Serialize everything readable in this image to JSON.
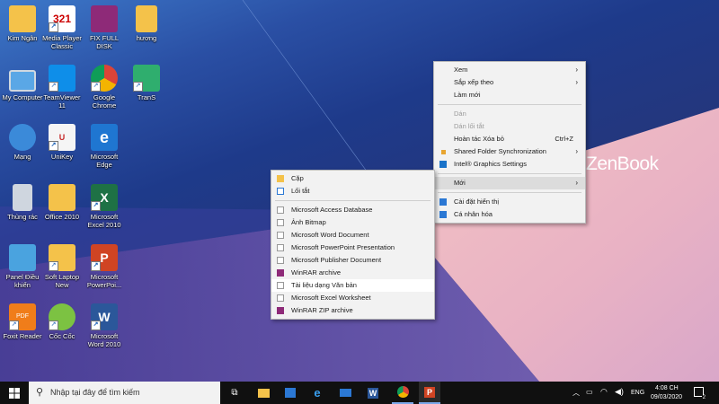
{
  "desktop": {
    "brand": "ZenBook",
    "icons": [
      {
        "label": "Kim Ngân",
        "icon": "folder-icon"
      },
      {
        "label": "Media Player Classic",
        "icon": "media-player-icon"
      },
      {
        "label": "FIX FULL DISK",
        "icon": "winrar-icon"
      },
      {
        "label": "hương",
        "icon": "folder-icon"
      },
      {
        "label": "My Computer",
        "icon": "computer-icon"
      },
      {
        "label": "TeamViewer 11",
        "icon": "teamviewer-icon"
      },
      {
        "label": "Google Chrome",
        "icon": "chrome-icon"
      },
      {
        "label": "TranS",
        "icon": "trans-icon"
      },
      {
        "label": "Mạng",
        "icon": "network-icon"
      },
      {
        "label": "UniKey",
        "icon": "unikey-icon"
      },
      {
        "label": "Microsoft Edge",
        "icon": "edge-icon"
      },
      {
        "label": "Thùng rác",
        "icon": "recycle-bin-icon"
      },
      {
        "label": "Office 2010",
        "icon": "folder-icon"
      },
      {
        "label": "Microsoft Excel 2010",
        "icon": "excel-icon"
      },
      {
        "label": "Panel Điều khiển",
        "icon": "control-panel-icon"
      },
      {
        "label": "Soft Laptop New",
        "icon": "folder-icon"
      },
      {
        "label": "Microsoft PowerPoi...",
        "icon": "powerpoint-icon"
      },
      {
        "label": "Foxit Reader",
        "icon": "foxit-icon"
      },
      {
        "label": "Cốc Cốc",
        "icon": "coccoc-icon"
      },
      {
        "label": "Microsoft Word 2010",
        "icon": "word-icon"
      }
    ]
  },
  "context_menu": {
    "items": [
      {
        "label": "Xem",
        "submenu": true
      },
      {
        "label": "Sắp xếp theo",
        "submenu": true
      },
      {
        "label": "Làm mới"
      },
      {
        "label": "Dán",
        "disabled": true
      },
      {
        "label": "Dán lối tắt",
        "disabled": true
      },
      {
        "label": "Hoàn tác Xóa bỏ",
        "shortcut": "Ctrl+Z"
      },
      {
        "label": "Shared Folder Synchronization",
        "submenu": true
      },
      {
        "label": "Intel® Graphics Settings"
      },
      {
        "label": "Mới",
        "submenu": true
      },
      {
        "label": "Cài đặt hiển thị"
      },
      {
        "label": "Cá nhân hóa"
      }
    ]
  },
  "new_submenu": {
    "items": [
      {
        "label": "Cặp",
        "icon": "folder-icon"
      },
      {
        "label": "Lối tắt",
        "icon": "shortcut-icon"
      },
      {
        "label": "Microsoft Access Database",
        "icon": "access-icon"
      },
      {
        "label": "Ảnh Bitmap",
        "icon": "bitmap-icon"
      },
      {
        "label": "Microsoft Word Document",
        "icon": "word-doc-icon"
      },
      {
        "label": "Microsoft PowerPoint Presentation",
        "icon": "powerpoint-doc-icon"
      },
      {
        "label": "Microsoft Publisher Document",
        "icon": "publisher-icon"
      },
      {
        "label": "WinRAR archive",
        "icon": "winrar-icon"
      },
      {
        "label": "Tài liệu dạng Văn bản",
        "icon": "text-doc-icon"
      },
      {
        "label": "Microsoft Excel Worksheet",
        "icon": "excel-doc-icon"
      },
      {
        "label": "WinRAR ZIP archive",
        "icon": "winrar-zip-icon"
      }
    ]
  },
  "taskbar": {
    "search_placeholder": "Nhập tại đây để tìm kiếm",
    "language": "ENG",
    "time": "4:08 CH",
    "date": "09/03/2020",
    "notification_count": "2"
  }
}
